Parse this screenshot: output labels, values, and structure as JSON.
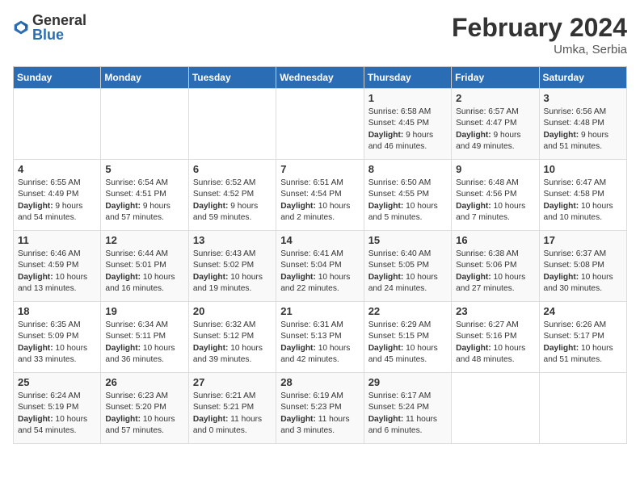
{
  "header": {
    "logo_general": "General",
    "logo_blue": "Blue",
    "month_year": "February 2024",
    "location": "Umka, Serbia"
  },
  "weekdays": [
    "Sunday",
    "Monday",
    "Tuesday",
    "Wednesday",
    "Thursday",
    "Friday",
    "Saturday"
  ],
  "weeks": [
    [
      {
        "day": "",
        "info": ""
      },
      {
        "day": "",
        "info": ""
      },
      {
        "day": "",
        "info": ""
      },
      {
        "day": "",
        "info": ""
      },
      {
        "day": "1",
        "sunrise": "Sunrise: 6:58 AM",
        "sunset": "Sunset: 4:45 PM",
        "daylight": "Daylight: 9 hours and 46 minutes."
      },
      {
        "day": "2",
        "sunrise": "Sunrise: 6:57 AM",
        "sunset": "Sunset: 4:47 PM",
        "daylight": "Daylight: 9 hours and 49 minutes."
      },
      {
        "day": "3",
        "sunrise": "Sunrise: 6:56 AM",
        "sunset": "Sunset: 4:48 PM",
        "daylight": "Daylight: 9 hours and 51 minutes."
      }
    ],
    [
      {
        "day": "4",
        "sunrise": "Sunrise: 6:55 AM",
        "sunset": "Sunset: 4:49 PM",
        "daylight": "Daylight: 9 hours and 54 minutes."
      },
      {
        "day": "5",
        "sunrise": "Sunrise: 6:54 AM",
        "sunset": "Sunset: 4:51 PM",
        "daylight": "Daylight: 9 hours and 57 minutes."
      },
      {
        "day": "6",
        "sunrise": "Sunrise: 6:52 AM",
        "sunset": "Sunset: 4:52 PM",
        "daylight": "Daylight: 9 hours and 59 minutes."
      },
      {
        "day": "7",
        "sunrise": "Sunrise: 6:51 AM",
        "sunset": "Sunset: 4:54 PM",
        "daylight": "Daylight: 10 hours and 2 minutes."
      },
      {
        "day": "8",
        "sunrise": "Sunrise: 6:50 AM",
        "sunset": "Sunset: 4:55 PM",
        "daylight": "Daylight: 10 hours and 5 minutes."
      },
      {
        "day": "9",
        "sunrise": "Sunrise: 6:48 AM",
        "sunset": "Sunset: 4:56 PM",
        "daylight": "Daylight: 10 hours and 7 minutes."
      },
      {
        "day": "10",
        "sunrise": "Sunrise: 6:47 AM",
        "sunset": "Sunset: 4:58 PM",
        "daylight": "Daylight: 10 hours and 10 minutes."
      }
    ],
    [
      {
        "day": "11",
        "sunrise": "Sunrise: 6:46 AM",
        "sunset": "Sunset: 4:59 PM",
        "daylight": "Daylight: 10 hours and 13 minutes."
      },
      {
        "day": "12",
        "sunrise": "Sunrise: 6:44 AM",
        "sunset": "Sunset: 5:01 PM",
        "daylight": "Daylight: 10 hours and 16 minutes."
      },
      {
        "day": "13",
        "sunrise": "Sunrise: 6:43 AM",
        "sunset": "Sunset: 5:02 PM",
        "daylight": "Daylight: 10 hours and 19 minutes."
      },
      {
        "day": "14",
        "sunrise": "Sunrise: 6:41 AM",
        "sunset": "Sunset: 5:04 PM",
        "daylight": "Daylight: 10 hours and 22 minutes."
      },
      {
        "day": "15",
        "sunrise": "Sunrise: 6:40 AM",
        "sunset": "Sunset: 5:05 PM",
        "daylight": "Daylight: 10 hours and 24 minutes."
      },
      {
        "day": "16",
        "sunrise": "Sunrise: 6:38 AM",
        "sunset": "Sunset: 5:06 PM",
        "daylight": "Daylight: 10 hours and 27 minutes."
      },
      {
        "day": "17",
        "sunrise": "Sunrise: 6:37 AM",
        "sunset": "Sunset: 5:08 PM",
        "daylight": "Daylight: 10 hours and 30 minutes."
      }
    ],
    [
      {
        "day": "18",
        "sunrise": "Sunrise: 6:35 AM",
        "sunset": "Sunset: 5:09 PM",
        "daylight": "Daylight: 10 hours and 33 minutes."
      },
      {
        "day": "19",
        "sunrise": "Sunrise: 6:34 AM",
        "sunset": "Sunset: 5:11 PM",
        "daylight": "Daylight: 10 hours and 36 minutes."
      },
      {
        "day": "20",
        "sunrise": "Sunrise: 6:32 AM",
        "sunset": "Sunset: 5:12 PM",
        "daylight": "Daylight: 10 hours and 39 minutes."
      },
      {
        "day": "21",
        "sunrise": "Sunrise: 6:31 AM",
        "sunset": "Sunset: 5:13 PM",
        "daylight": "Daylight: 10 hours and 42 minutes."
      },
      {
        "day": "22",
        "sunrise": "Sunrise: 6:29 AM",
        "sunset": "Sunset: 5:15 PM",
        "daylight": "Daylight: 10 hours and 45 minutes."
      },
      {
        "day": "23",
        "sunrise": "Sunrise: 6:27 AM",
        "sunset": "Sunset: 5:16 PM",
        "daylight": "Daylight: 10 hours and 48 minutes."
      },
      {
        "day": "24",
        "sunrise": "Sunrise: 6:26 AM",
        "sunset": "Sunset: 5:17 PM",
        "daylight": "Daylight: 10 hours and 51 minutes."
      }
    ],
    [
      {
        "day": "25",
        "sunrise": "Sunrise: 6:24 AM",
        "sunset": "Sunset: 5:19 PM",
        "daylight": "Daylight: 10 hours and 54 minutes."
      },
      {
        "day": "26",
        "sunrise": "Sunrise: 6:23 AM",
        "sunset": "Sunset: 5:20 PM",
        "daylight": "Daylight: 10 hours and 57 minutes."
      },
      {
        "day": "27",
        "sunrise": "Sunrise: 6:21 AM",
        "sunset": "Sunset: 5:21 PM",
        "daylight": "Daylight: 11 hours and 0 minutes."
      },
      {
        "day": "28",
        "sunrise": "Sunrise: 6:19 AM",
        "sunset": "Sunset: 5:23 PM",
        "daylight": "Daylight: 11 hours and 3 minutes."
      },
      {
        "day": "29",
        "sunrise": "Sunrise: 6:17 AM",
        "sunset": "Sunset: 5:24 PM",
        "daylight": "Daylight: 11 hours and 6 minutes."
      },
      {
        "day": "",
        "info": ""
      },
      {
        "day": "",
        "info": ""
      }
    ]
  ]
}
